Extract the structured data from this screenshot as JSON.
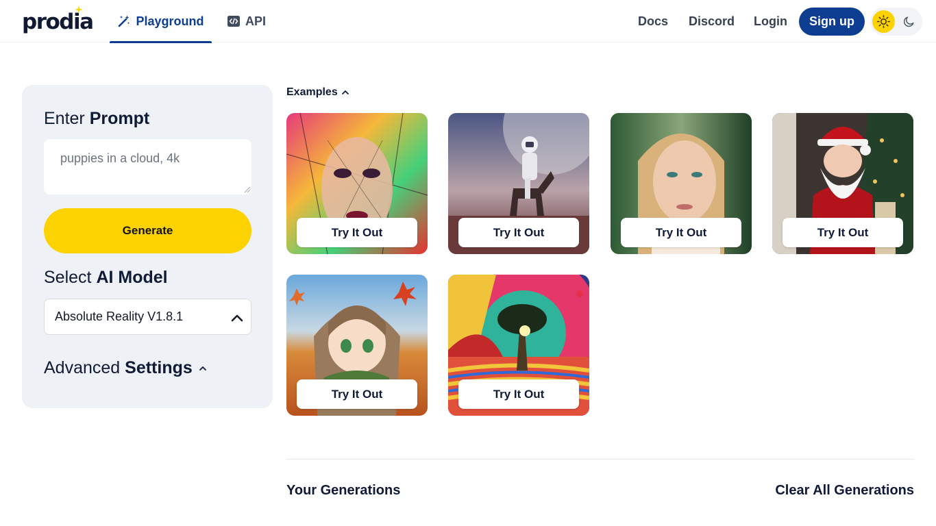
{
  "header": {
    "logo_text": "prodia",
    "tabs": [
      {
        "label": "Playground",
        "icon": "magic-wand-icon",
        "active": true
      },
      {
        "label": "API",
        "icon": "code-icon",
        "active": false
      }
    ],
    "links": [
      "Docs",
      "Discord",
      "Login"
    ],
    "signup_label": "Sign up",
    "theme": {
      "light_icon": "sun-icon",
      "dark_icon": "moon-icon",
      "selected": "light"
    }
  },
  "sidebar": {
    "prompt_heading": {
      "light": "Enter",
      "bold": "Prompt"
    },
    "prompt_placeholder": "puppies in a cloud, 4k",
    "generate_label": "Generate",
    "model_heading": {
      "light": "Select",
      "bold": "AI Model"
    },
    "model_selected": "Absolute Reality V1.8.1",
    "settings_heading": {
      "light": "Advanced",
      "bold": "Settings"
    }
  },
  "examples": {
    "toggle_label": "Examples",
    "cards": [
      {
        "button_label": "Try It Out"
      },
      {
        "button_label": "Try It Out"
      },
      {
        "button_label": "Try It Out"
      },
      {
        "button_label": "Try It Out"
      },
      {
        "button_label": "Try It Out"
      },
      {
        "button_label": "Try It Out"
      }
    ]
  },
  "generations": {
    "title": "Your Generations",
    "clear_label": "Clear All Generations"
  },
  "colors": {
    "brand_blue": "#0c3d91",
    "accent_yellow": "#fcd200",
    "panel_bg": "#eef2f7"
  }
}
